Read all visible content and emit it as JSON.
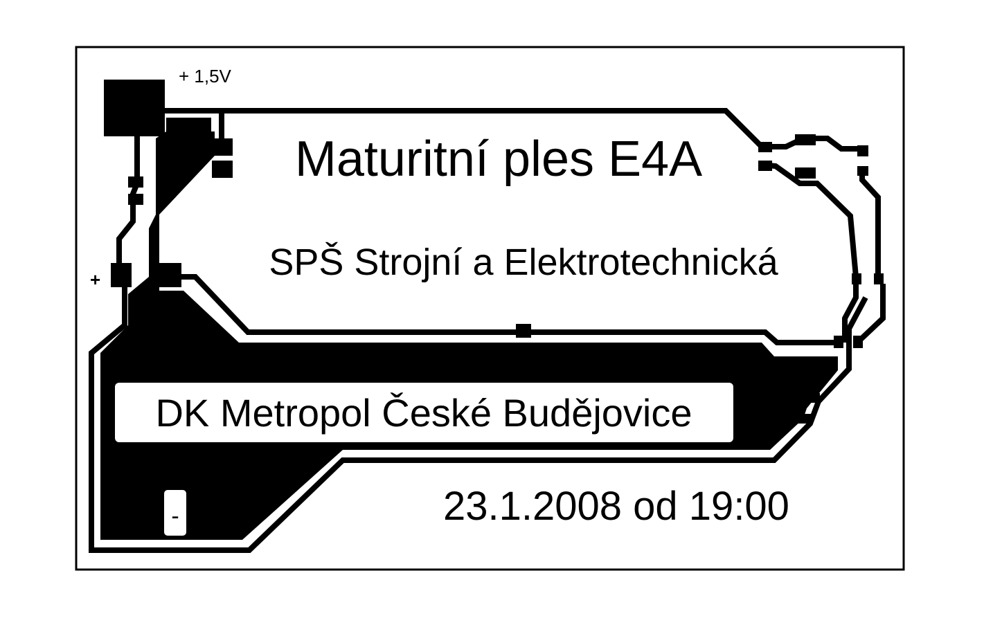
{
  "labels": {
    "voltage": "+ 1,5V",
    "plus_terminal": "+",
    "minus_terminal": "-",
    "title": "Maturitní ples E4A",
    "school": "SPŠ Strojní a Elektrotechnická",
    "venue": "DK Metropol České Budějovice",
    "datetime": "23.1.2008  od 19:00"
  },
  "colors": {
    "copper": "#000000",
    "board": "#ffffff"
  }
}
